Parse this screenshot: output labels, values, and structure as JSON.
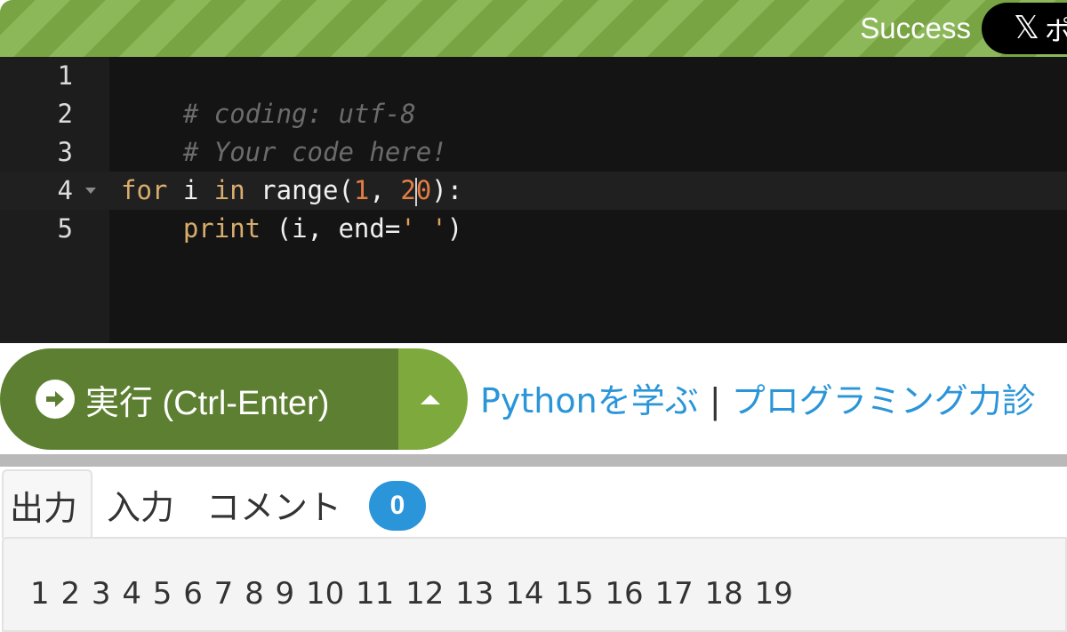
{
  "status": {
    "text": "Success",
    "share_x": "𝕏",
    "share_rest": "ポ"
  },
  "editor": {
    "line_numbers": [
      "1",
      "2",
      "3",
      "4",
      "5"
    ],
    "lines": {
      "l1": "# coding: utf-8",
      "l2": "# Your code here!",
      "l4": {
        "kw_for": "for",
        "var_i": " i ",
        "kw_in": "in",
        "fn_range": " range(",
        "n1": "1",
        "comma": ", ",
        "n2a": "2",
        "n2b": "0",
        "close": "):"
      },
      "l5": {
        "indent": "    ",
        "kw_print": "print",
        "args": " (i, end=",
        "str": "' '",
        "close": ")"
      }
    }
  },
  "run": {
    "label": "実行 (Ctrl-Enter)"
  },
  "nav": {
    "learn": "Pythonを学ぶ",
    "sep": " | ",
    "more": "プログラミング力診"
  },
  "tabs": {
    "output": "出力",
    "input": "入力",
    "comments": "コメント",
    "comments_count": "0"
  },
  "output": {
    "text": "1 2 3 4 5 6 7 8 9 10 11 12 13 14 15 16 17 18 19"
  },
  "colors": {
    "accent_green": "#5d7f31",
    "link_blue": "#2a95d8",
    "editor_bg": "#141414"
  }
}
